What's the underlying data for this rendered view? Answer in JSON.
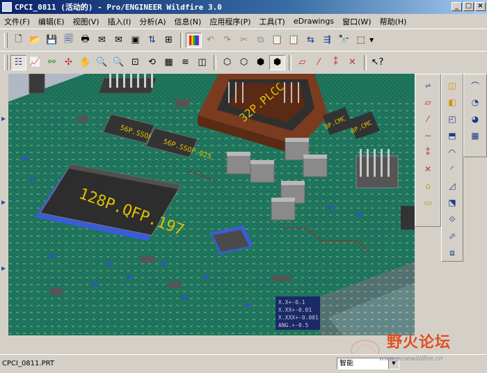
{
  "window": {
    "title": "CPCI_0811 (活动的) - Pro/ENGINEER Wildfire 3.0"
  },
  "menu": [
    {
      "label": "文件(F)"
    },
    {
      "label": "编辑(E)"
    },
    {
      "label": "视图(V)"
    },
    {
      "label": "插入(I)"
    },
    {
      "label": "分析(A)"
    },
    {
      "label": "信息(N)"
    },
    {
      "label": "应用程序(P)"
    },
    {
      "label": "工具(T)"
    },
    {
      "label": "eDrawings"
    },
    {
      "label": "窗口(W)"
    },
    {
      "label": "帮助(H)"
    }
  ],
  "pcb": {
    "chip_qfp": "128P.QFP.197",
    "chip_plcc": "32P.PLCC",
    "chip_small_1": "56P.SSOP.025",
    "chip_small_2": "56P.SSOP.025",
    "chip_small_3": "8P.CMC",
    "chip_small_4": "8P.CMC"
  },
  "tolerances": [
    "X.X+-0.1",
    "X.XX+-0.01",
    "X.XXX+-0.001",
    "ANG.+-0.5"
  ],
  "status": {
    "filename": "CPCI_0811.PRT",
    "filter": "智能"
  },
  "logo": {
    "name": "野火论坛",
    "url": "www.proewildfire.cn"
  },
  "colors": {
    "board": "#1d7a5a",
    "pad": "#2d4ccc",
    "component": "#444",
    "plcc": "#7a3b1f",
    "title_start": "#0a246a"
  }
}
